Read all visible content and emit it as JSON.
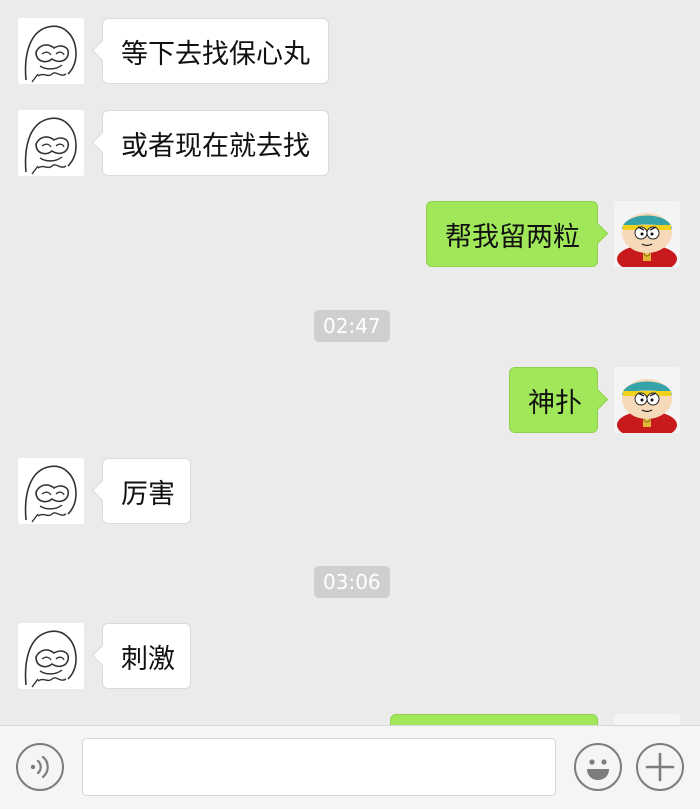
{
  "conversation": {
    "messages": [
      {
        "side": "in",
        "text": "等下去找保心丸",
        "avatar": "sketch-face-avatar"
      },
      {
        "side": "in",
        "text": "或者现在就去找",
        "avatar": "sketch-face-avatar"
      },
      {
        "side": "out",
        "text": "帮我留两粒",
        "avatar": "cartman-avatar"
      },
      {
        "side": "out",
        "text": "神扑",
        "avatar": "cartman-avatar"
      },
      {
        "side": "in",
        "text": "厉害",
        "avatar": "sketch-face-avatar"
      },
      {
        "side": "in",
        "text": "刺激",
        "avatar": "sketch-face-avatar"
      },
      {
        "side": "out",
        "text": "",
        "avatar": "cartman-avatar"
      }
    ],
    "timestamps": [
      "02:47",
      "03:06"
    ]
  },
  "input_bar": {
    "voice_icon": "voice-icon",
    "text_value": "",
    "emoji_icon": "emoji-icon",
    "plus_icon": "plus-icon"
  },
  "colors": {
    "background": "#ebebeb",
    "incoming_bubble": "#ffffff",
    "outgoing_bubble": "#a0e75a",
    "timestamp_bg": "#cfcfcf"
  }
}
